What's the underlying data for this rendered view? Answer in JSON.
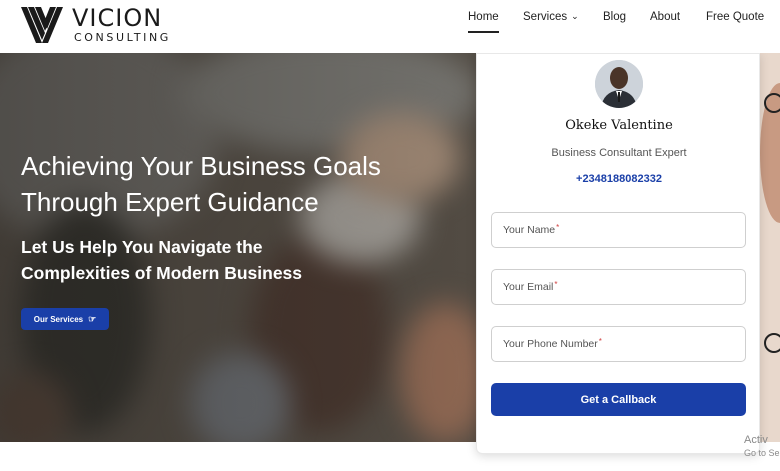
{
  "brand": {
    "name": "VICION",
    "tagline": "CONSULTING"
  },
  "nav": [
    {
      "label": "Home",
      "active": true
    },
    {
      "label": "Services",
      "has_dropdown": true
    },
    {
      "label": "Blog"
    },
    {
      "label": "About"
    },
    {
      "label": "Free Quote"
    }
  ],
  "hero": {
    "title_line1": "Achieving Your Business Goals",
    "title_line2": "Through Expert Guidance",
    "subtitle_line1": "Let Us Help You Navigate the",
    "subtitle_line2": "Complexities of Modern Business",
    "button_label": "Our Services",
    "button_icon": "hand-pointing-icon"
  },
  "card": {
    "name": "Okeke Valentine",
    "role": "Business Consultant Expert",
    "phone": "+2348188082332",
    "fields": [
      {
        "placeholder": "Your Name",
        "required": true
      },
      {
        "placeholder": "Your Email",
        "required": true
      },
      {
        "placeholder": "Your Phone Number",
        "required": true
      }
    ],
    "required_mark": "*",
    "submit_label": "Get a Callback"
  },
  "watermark": {
    "line1": "Activ",
    "line2": "Go to Se"
  },
  "colors": {
    "accent": "#1a3fa8",
    "text": "#222222"
  }
}
